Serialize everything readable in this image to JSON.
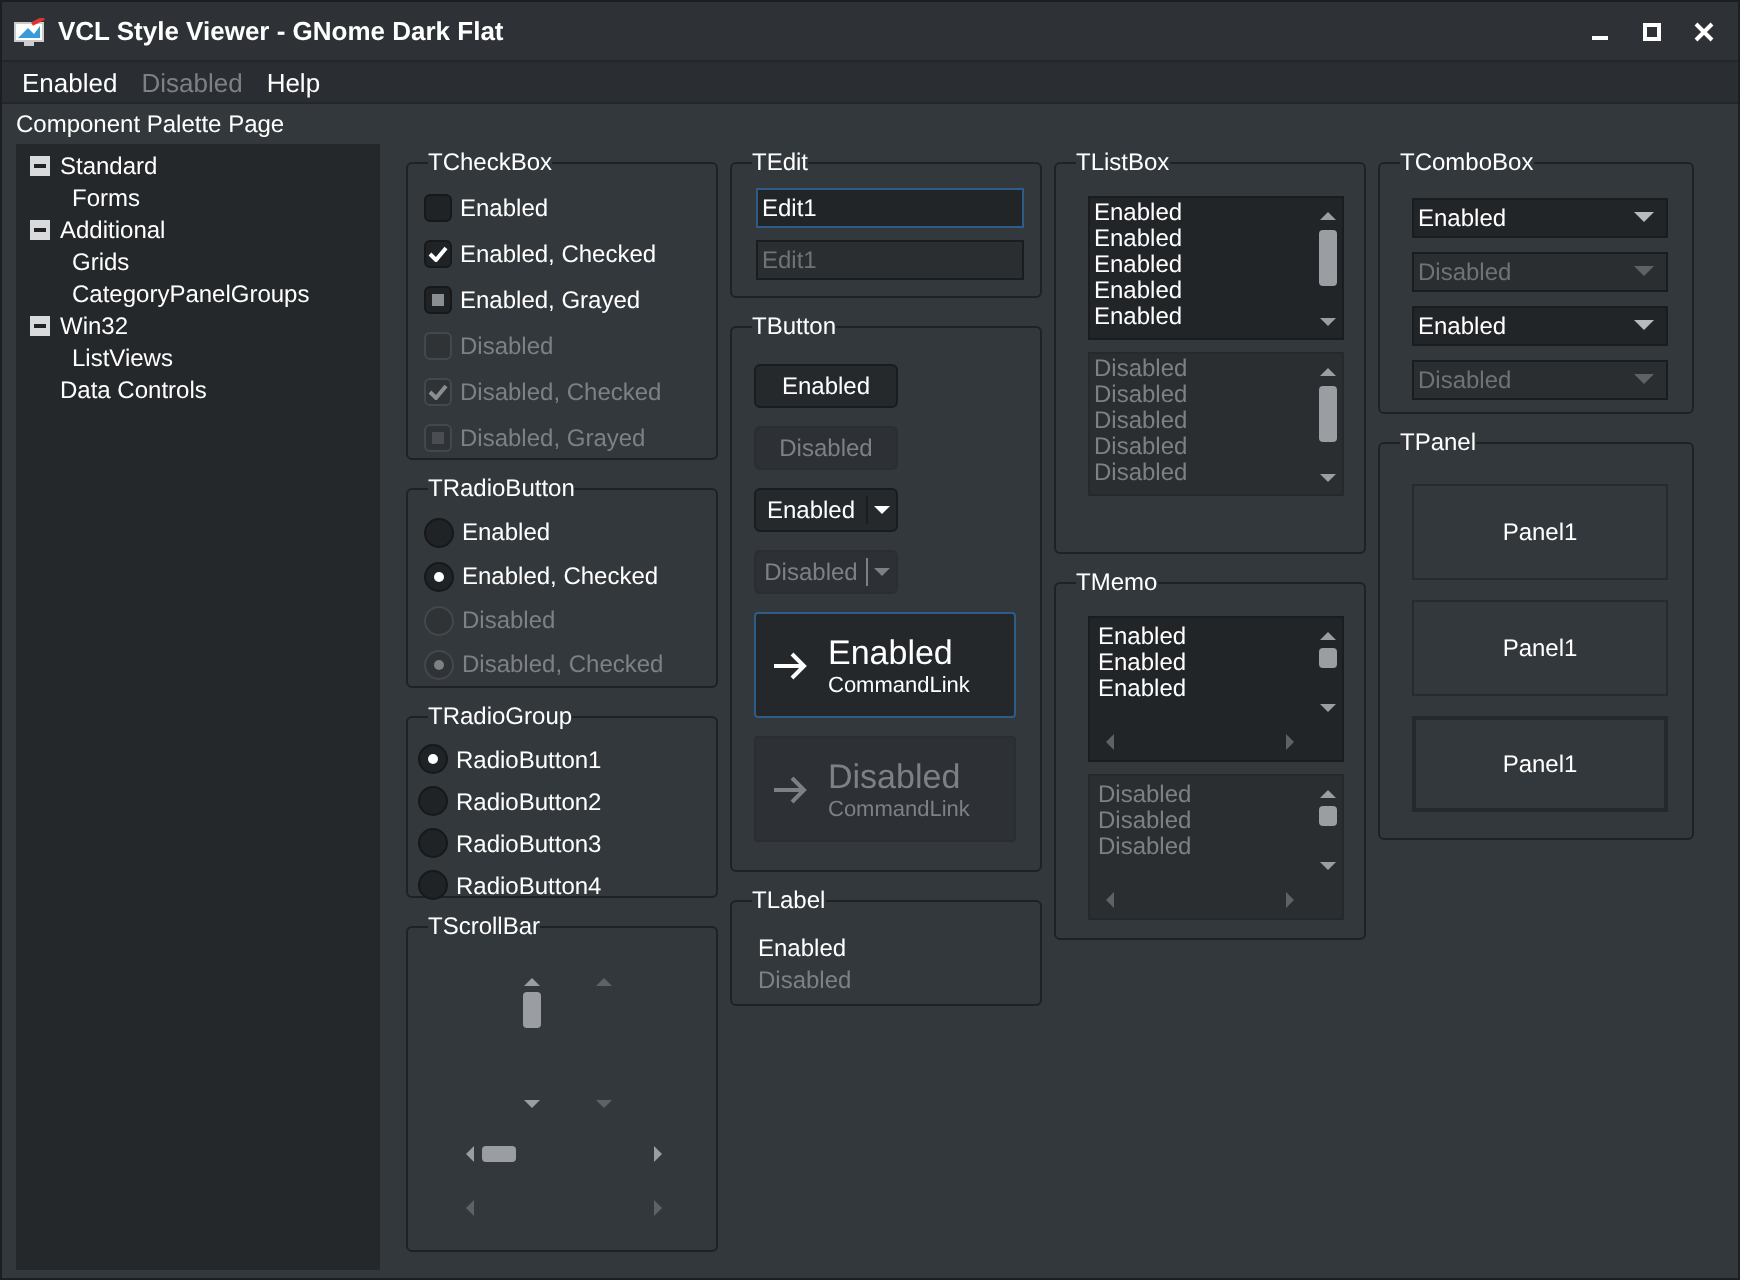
{
  "window": {
    "title": "VCL Style Viewer - GNome Dark Flat"
  },
  "menu": [
    {
      "label": "Enabled",
      "disabled": false
    },
    {
      "label": "Disabled",
      "disabled": true
    },
    {
      "label": "Help",
      "disabled": false
    }
  ],
  "palette_label": "Component Palette Page",
  "tree": [
    {
      "label": "Standard",
      "expanded": true,
      "children": [
        {
          "label": "Forms"
        }
      ]
    },
    {
      "label": "Additional",
      "expanded": true,
      "children": [
        {
          "label": "Grids"
        },
        {
          "label": "CategoryPanelGroups"
        }
      ]
    },
    {
      "label": "Win32",
      "expanded": true,
      "children": [
        {
          "label": "ListViews"
        }
      ]
    },
    {
      "label": "Data Controls"
    }
  ],
  "checkboxes": {
    "title": "TCheckBox",
    "items": [
      {
        "label": "Enabled",
        "checked": false,
        "grayed": false,
        "disabled": false
      },
      {
        "label": "Enabled, Checked",
        "checked": true,
        "grayed": false,
        "disabled": false
      },
      {
        "label": "Enabled, Grayed",
        "checked": false,
        "grayed": true,
        "disabled": false
      },
      {
        "label": "Disabled",
        "checked": false,
        "grayed": false,
        "disabled": true
      },
      {
        "label": "Disabled, Checked",
        "checked": true,
        "grayed": false,
        "disabled": true
      },
      {
        "label": "Disabled, Grayed",
        "checked": false,
        "grayed": true,
        "disabled": true
      }
    ]
  },
  "radio_buttons": {
    "title": "TRadioButton",
    "items": [
      {
        "label": "Enabled",
        "checked": false,
        "disabled": false
      },
      {
        "label": "Enabled, Checked",
        "checked": true,
        "disabled": false
      },
      {
        "label": "Disabled",
        "checked": false,
        "disabled": true
      },
      {
        "label": "Disabled, Checked",
        "checked": true,
        "disabled": true
      }
    ]
  },
  "radio_group": {
    "title": "TRadioGroup",
    "items": [
      {
        "label": "RadioButton1",
        "selected": true
      },
      {
        "label": "RadioButton2",
        "selected": false
      },
      {
        "label": "RadioButton3",
        "selected": false
      },
      {
        "label": "RadioButton4",
        "selected": false
      }
    ]
  },
  "scroll_bars": {
    "title": "TScrollBar",
    "items": [
      {
        "kind": "vertical",
        "disabled": false
      },
      {
        "kind": "vertical",
        "disabled": true
      },
      {
        "kind": "horizontal",
        "disabled": false
      },
      {
        "kind": "horizontal",
        "disabled": true
      }
    ]
  },
  "edits": {
    "title": "TEdit",
    "items": [
      {
        "value": "Edit1",
        "disabled": false,
        "focused": true
      },
      {
        "value": "Edit1",
        "disabled": true,
        "focused": false
      }
    ]
  },
  "buttons": {
    "title": "TButton",
    "items": [
      {
        "kind": "push",
        "label": "Enabled",
        "disabled": false
      },
      {
        "kind": "push",
        "label": "Disabled",
        "disabled": true
      },
      {
        "kind": "split",
        "label": "Enabled",
        "disabled": false
      },
      {
        "kind": "split",
        "label": "Disabled",
        "disabled": true
      },
      {
        "kind": "command",
        "label": "Enabled",
        "note": "CommandLink",
        "disabled": false,
        "focused": true
      },
      {
        "kind": "command",
        "label": "Disabled",
        "note": "CommandLink",
        "disabled": true,
        "focused": false
      }
    ]
  },
  "labels": {
    "title": "TLabel",
    "items": [
      {
        "text": "Enabled",
        "disabled": false
      },
      {
        "text": "Disabled",
        "disabled": true
      }
    ]
  },
  "list_boxes": {
    "title": "TListBox",
    "items": [
      {
        "disabled": false,
        "entries": [
          "Enabled",
          "Enabled",
          "Enabled",
          "Enabled",
          "Enabled"
        ]
      },
      {
        "disabled": true,
        "entries": [
          "Disabled",
          "Disabled",
          "Disabled",
          "Disabled",
          "Disabled"
        ]
      }
    ]
  },
  "memos": {
    "title": "TMemo",
    "items": [
      {
        "disabled": false,
        "lines": [
          "Enabled",
          "Enabled",
          "Enabled"
        ]
      },
      {
        "disabled": true,
        "lines": [
          "Disabled",
          "Disabled",
          "Disabled"
        ]
      }
    ]
  },
  "combo_boxes": {
    "title": "TComboBox",
    "items": [
      {
        "value": "Enabled",
        "disabled": false
      },
      {
        "value": "Disabled",
        "disabled": true
      },
      {
        "value": "Enabled",
        "disabled": false
      },
      {
        "value": "Disabled",
        "disabled": true
      }
    ]
  },
  "panels": {
    "title": "TPanel",
    "items": [
      {
        "label": "Panel1",
        "kind": "flat"
      },
      {
        "label": "Panel1",
        "kind": "flat"
      },
      {
        "label": "Panel1",
        "kind": "sunken"
      }
    ]
  }
}
